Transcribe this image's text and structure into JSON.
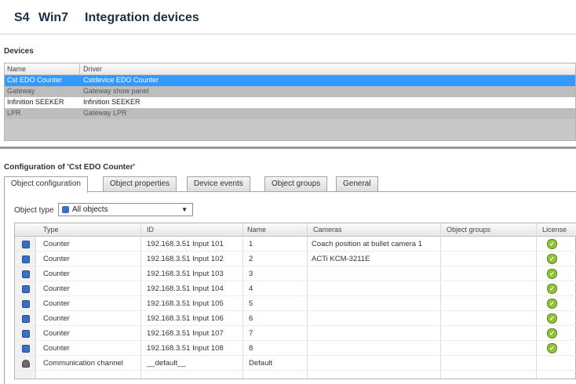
{
  "title": {
    "prefix": "S4",
    "host": "Win7",
    "text": "Integration devices"
  },
  "devices": {
    "label": "Devices",
    "columns": [
      "Name",
      "Driver"
    ],
    "rows": [
      {
        "name": "Cst EDO Counter",
        "driver": "Cstdevice EDO Counter"
      },
      {
        "name": "Gateway",
        "driver": "Gateway show panel"
      },
      {
        "name": "Infinition SEEKER",
        "driver": "Infinition SEEKER"
      },
      {
        "name": "LPR",
        "driver": "Gateway LPR"
      }
    ]
  },
  "config": {
    "label": "Configuration of 'Cst EDO Counter'",
    "tabs": [
      "Object configuration",
      "Object properties",
      "Device events",
      "Object groups",
      "General"
    ]
  },
  "object_type": {
    "label": "Object type",
    "value": "All objects"
  },
  "objects": {
    "columns": [
      "Type",
      "ID",
      "Name",
      "Cameras",
      "Object groups",
      "License"
    ],
    "rows": [
      {
        "type": "Counter",
        "id": "192.168.3.51 Input 101",
        "name": "1",
        "cameras": "Coach position at bullet camera 1"
      },
      {
        "type": "Counter",
        "id": "192.168.3.51 Input 102",
        "name": "2",
        "cameras": "ACTi KCM-3211E"
      },
      {
        "type": "Counter",
        "id": "192.168.3.51 Input 103",
        "name": "3",
        "cameras": ""
      },
      {
        "type": "Counter",
        "id": "192.168.3.51 Input 104",
        "name": "4",
        "cameras": ""
      },
      {
        "type": "Counter",
        "id": "192.168.3.51 Input 105",
        "name": "5",
        "cameras": ""
      },
      {
        "type": "Counter",
        "id": "192.168.3.51 Input 106",
        "name": "6",
        "cameras": ""
      },
      {
        "type": "Counter",
        "id": "192.168.3.51 Input 107",
        "name": "7",
        "cameras": ""
      },
      {
        "type": "Counter",
        "id": "192.168.3.51 Input 108",
        "name": "8",
        "cameras": ""
      },
      {
        "type": "Communication channel",
        "id": "__default__",
        "name": "Default",
        "cameras": ""
      }
    ]
  },
  "colors": {
    "selected_row": "#3399ff",
    "gray_row": "#bdbdbd",
    "accent_title": "#1d2f44"
  }
}
